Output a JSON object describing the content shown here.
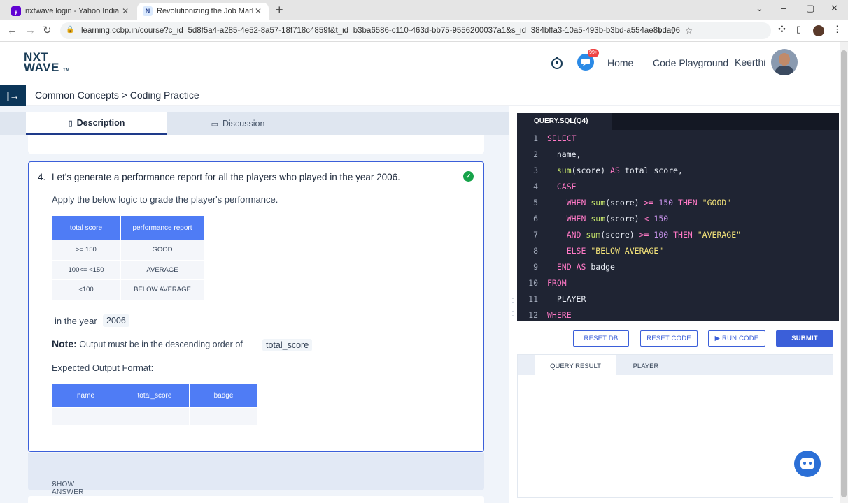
{
  "browser": {
    "tabs": [
      {
        "label": "nxtwave login - Yahoo India Sea",
        "favicon": "yahoo-favicon"
      },
      {
        "label": "Revolutionizing the Job Market |",
        "favicon": "nxtwave-favicon"
      }
    ],
    "url": "learning.ccbp.in/course?c_id=5d8f5a4-a285-4e52-8a57-18f718c4859f&t_id=b3ba6586-c110-463d-bb75-9556200037a1&s_id=384bffa3-10a5-493b-b3bd-a554ae8bda06"
  },
  "header": {
    "logo_line1": "NXT",
    "logo_line2": "WAVE",
    "logo_tm": "TM",
    "notification_badge": "99+",
    "nav": [
      "Home",
      "Code Playground"
    ],
    "user_name": "Keerthi"
  },
  "breadcrumb": "Common Concepts > Coding Practice",
  "left_tabs": {
    "description": "Description",
    "discussion": "Discussion"
  },
  "question": {
    "number": "4.",
    "text": "Let's generate a performance report for all the players who played in the year 2006.",
    "apply_text": "Apply the below logic to grade the player's performance.",
    "grade_table": {
      "headers": [
        "total score",
        "performance report"
      ],
      "rows": [
        [
          ">= 150",
          "GOOD"
        ],
        [
          "100<= <150",
          "AVERAGE"
        ],
        [
          "<100",
          "BELOW AVERAGE"
        ]
      ]
    },
    "year_label": "in the year",
    "year_value": "2006",
    "note_label": "Note:",
    "note_text": "Output must be in the descending order of",
    "note_field": "total_score",
    "expected_label": "Expected Output Format:",
    "output_table": {
      "headers": [
        "name",
        "total_score",
        "badge"
      ],
      "row": [
        "...",
        "...",
        "..."
      ]
    },
    "show_answer": "SHOW ANSWER"
  },
  "editor": {
    "tab_label": "QUERY.SQL(Q4)",
    "line_numbers": [
      "1",
      "2",
      "3",
      "4",
      "5",
      "6",
      "7",
      "8",
      "9",
      "10",
      "11",
      "12"
    ]
  },
  "actions": {
    "reset_db": "RESET DB",
    "reset_code": "RESET CODE",
    "run_code": "RUN CODE",
    "submit": "SUBMIT"
  },
  "result_tabs": {
    "query_result": "QUERY RESULT",
    "player": "PLAYER"
  }
}
